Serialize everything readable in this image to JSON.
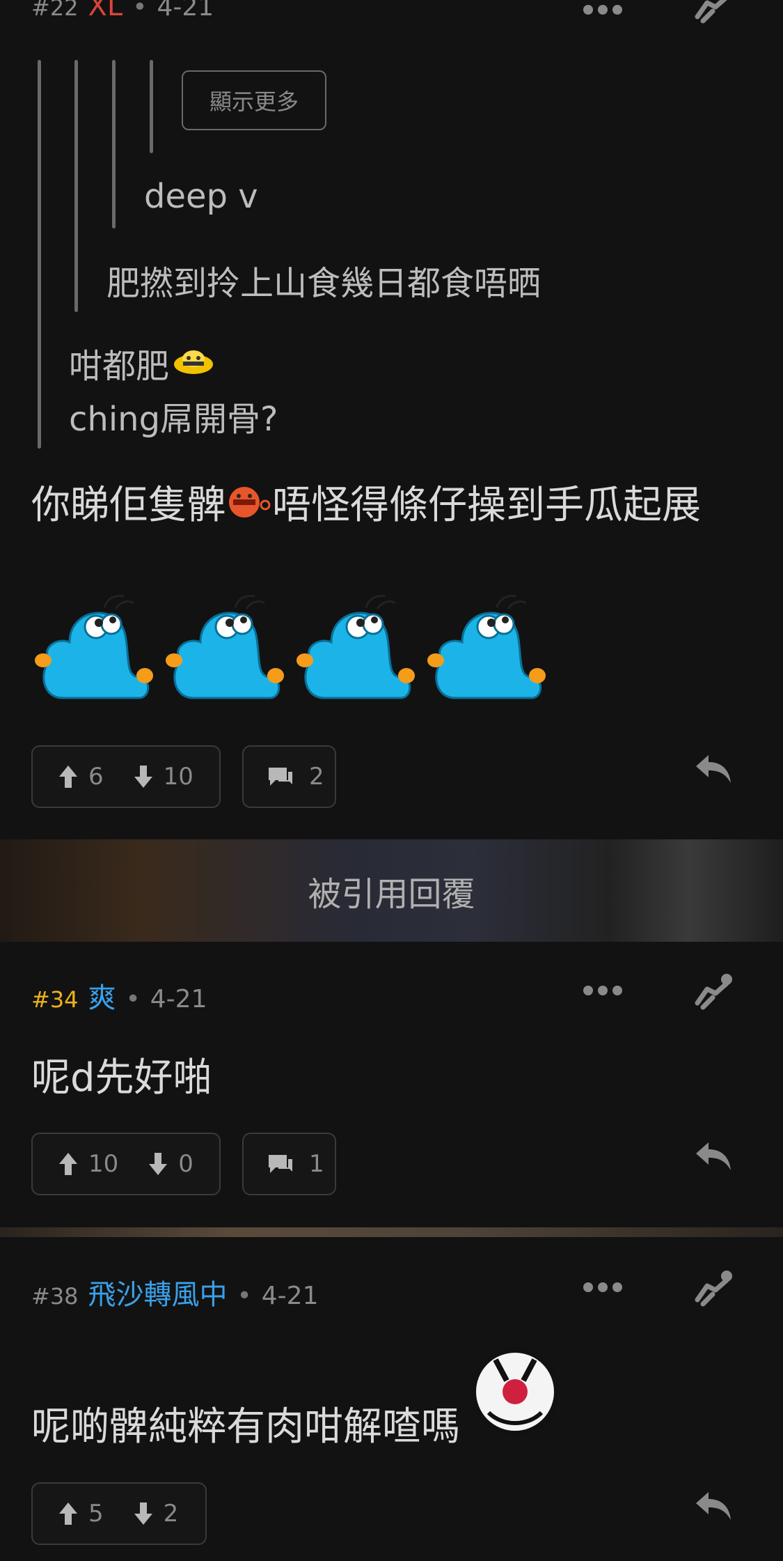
{
  "post22": {
    "num": "#22",
    "user": "XL",
    "dot": "•",
    "date": "4-21",
    "show_more": "顯示更多",
    "quote3": "deep v",
    "quote2": "肥撚到拎上山食幾日都食唔晒",
    "quote1_line1": "咁都肥",
    "quote1_line2": "ching屌開骨?",
    "body_part1": "你睇佢隻髀",
    "body_part2": " 唔怪得條仔操到手瓜起展",
    "upvotes": "6",
    "downvotes": "10",
    "comments": "2"
  },
  "banner": {
    "label": "被引用回覆"
  },
  "post34": {
    "num": "#34",
    "user": "爽",
    "dot": "•",
    "date": "4-21",
    "body": "呢d先好啪",
    "upvotes": "10",
    "downvotes": "0",
    "comments": "1"
  },
  "post38": {
    "num": "#38",
    "user": "飛沙轉風中",
    "dot": "•",
    "date": "4-21",
    "body": "呢啲髀純粹有肉咁解喳嗎",
    "upvotes": "5",
    "downvotes": "2"
  },
  "icons": [
    "more-icon",
    "filter-icon",
    "upvote-icon",
    "downvote-icon",
    "comment-icon",
    "reply-icon",
    "emoji-icon"
  ],
  "colors": {
    "bg": "#121212",
    "user_red": "#d8453a",
    "user_blue": "#3aa0e8",
    "num_gold": "#f0b21b",
    "muted": "#8a8a8a"
  }
}
